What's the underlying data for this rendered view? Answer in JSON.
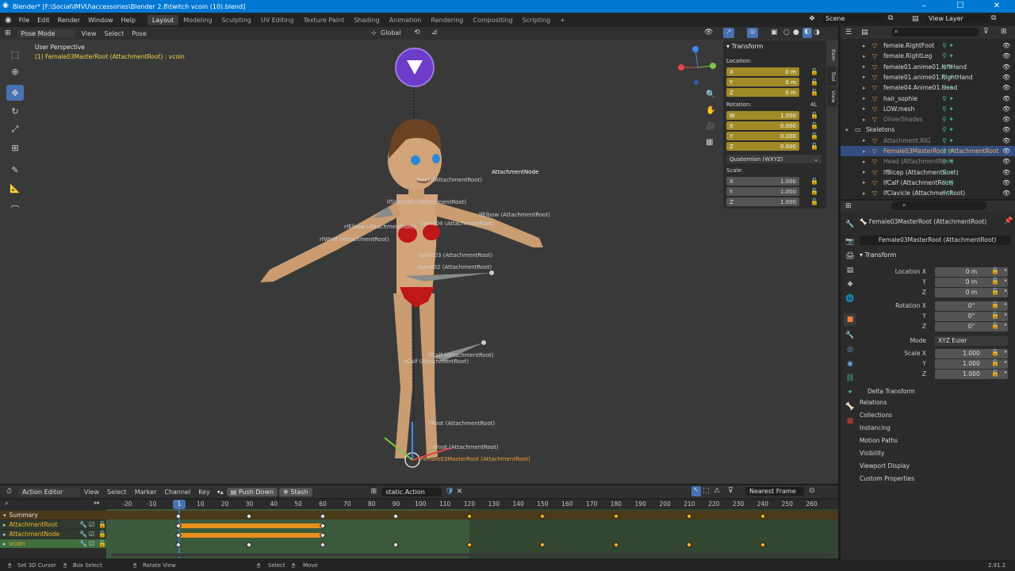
{
  "window": {
    "title": "Blender* [F:\\Social\\IMVU\\accessories\\Blender 2.8\\twitch vcoin (10).blend]",
    "minimize": "–",
    "maximize": "☐",
    "close": "✕"
  },
  "menu": [
    "File",
    "Edit",
    "Render",
    "Window",
    "Help"
  ],
  "workspaces": [
    "Layout",
    "Modeling",
    "Sculpting",
    "UV Editing",
    "Texture Paint",
    "Shading",
    "Animation",
    "Rendering",
    "Compositing",
    "Scripting"
  ],
  "scene": {
    "label": "Scene",
    "view_layer": "View Layer"
  },
  "viewport_header": {
    "mode": "Pose Mode",
    "menus": [
      "View",
      "Select",
      "Pose"
    ],
    "orientation": "Global"
  },
  "viewport": {
    "perspective": "User Perspective",
    "active": "(1) Female03MasterRoot (AttachmentRoot) : vcoin",
    "bone_labels": [
      "AttachmentNode",
      "Spine04 (AttachmentRoot)",
      "Spine03 (AttachmentRoot)",
      "Spine02 (AttachmentRoot)",
      "rCalf (AttachmentRoot)",
      "lfCalf (AttachmentRoot)",
      "lfElbow (AttachmentRoot)",
      "rfElbow (AttachmentRoot)",
      "rfWrist (AttachmentRoot)",
      "lfShoulder (AttachmentRoot)",
      "Neck (AttachmentRoot)",
      "Female03MasterRoot (AttachmentRoot)",
      "lfFoot (AttachmentRoot)",
      "rFoot (AttachmentRoot)"
    ]
  },
  "npanel": {
    "title": "Transform",
    "location_label": "Location:",
    "rotation_label": "Rotation:",
    "rotation_mode_short": "4L",
    "scale_label": "Scale:",
    "location": [
      {
        "axis": "X",
        "value": "0 m"
      },
      {
        "axis": "Y",
        "value": "0 m"
      },
      {
        "axis": "Z",
        "value": "0 m"
      }
    ],
    "rotation": [
      {
        "axis": "W",
        "value": "1.000"
      },
      {
        "axis": "X",
        "value": "0.000"
      },
      {
        "axis": "Y",
        "value": "0.000"
      },
      {
        "axis": "Z",
        "value": "0.000"
      }
    ],
    "rotation_mode": "Quaternion (WXYZ)",
    "scale": [
      {
        "axis": "X",
        "value": "1.000"
      },
      {
        "axis": "Y",
        "value": "1.000"
      },
      {
        "axis": "Z",
        "value": "1.000"
      }
    ],
    "tabs": [
      "Item",
      "Tool",
      "View"
    ]
  },
  "outliner": {
    "search_placeholder": "",
    "rows": [
      {
        "name": "female.RightFoot"
      },
      {
        "name": "female.RightLeg"
      },
      {
        "name": "female01.anime01.leftHand"
      },
      {
        "name": "female01.anime01.RightHand"
      },
      {
        "name": "female04.Anime01.Head"
      },
      {
        "name": "hair_sophie"
      },
      {
        "name": "LOW.mesh"
      },
      {
        "name": "OliverShades"
      },
      {
        "name": "Skeletons"
      },
      {
        "name": "Attachment.RIG"
      },
      {
        "name": "Female03MasterRoot (AttachmentRoot"
      },
      {
        "name": "Head (AttachmentRoot)"
      },
      {
        "name": "lfBicep (AttachmentRoot)"
      },
      {
        "name": "lfCalf (AttachmentRoot)"
      },
      {
        "name": "lfClavicle (AttachmentRoot)"
      }
    ]
  },
  "properties": {
    "header": "Female03MasterRoot (AttachmentRoot)",
    "bone_name": "Female03MasterRoot (AttachmentRoot)",
    "transform_title": "Transform",
    "location": [
      {
        "label": "Location X",
        "value": "0 m"
      },
      {
        "label": "Y",
        "value": "0 m"
      },
      {
        "label": "Z",
        "value": "0 m"
      }
    ],
    "rotation": [
      {
        "label": "Rotation X",
        "value": "0°"
      },
      {
        "label": "Y",
        "value": "0°"
      },
      {
        "label": "Z",
        "value": "0°"
      }
    ],
    "mode_label": "Mode",
    "mode": "XYZ Euler",
    "scale": [
      {
        "label": "Scale X",
        "value": "1.000"
      },
      {
        "label": "Y",
        "value": "1.000"
      },
      {
        "label": "Z",
        "value": "1.000"
      }
    ],
    "sections": [
      "Delta Transform",
      "Relations",
      "Collections",
      "Instancing",
      "Motion Paths",
      "Visibility",
      "Viewport Display",
      "Custom Properties"
    ]
  },
  "dopesheet": {
    "mode": "Action Editor",
    "menus": [
      "View",
      "Select",
      "Marker",
      "Channel",
      "Key"
    ],
    "push_down": "Push Down",
    "stash": "Stash",
    "action": "static.Action",
    "snap": "Nearest Frame",
    "current_frame": "1",
    "ruler": [
      "-20",
      "-10",
      "10",
      "20",
      "30",
      "40",
      "50",
      "60",
      "70",
      "80",
      "90",
      "100",
      "110",
      "120",
      "130",
      "140",
      "150",
      "160",
      "170",
      "180",
      "190",
      "200",
      "210",
      "220",
      "230",
      "240",
      "250",
      "260"
    ],
    "channels": [
      "Summary",
      "AttachmentRoot",
      "AttachmentNode",
      "vcoin"
    ]
  },
  "status": {
    "items": [
      "Set 3D Cursor",
      "Box Select",
      "Rotate View",
      "Select",
      "Move"
    ],
    "version": "2.91.2"
  }
}
